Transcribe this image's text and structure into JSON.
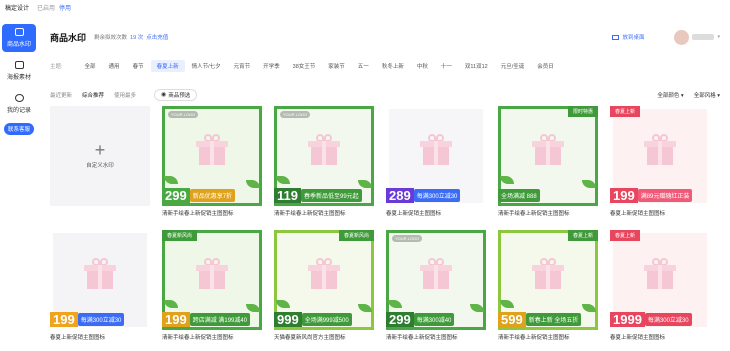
{
  "topbar": {
    "brand": "稿定设计",
    "sep": "·",
    "status": "已启用",
    "action": "停用"
  },
  "sidebar": {
    "items": [
      {
        "label": "商品水印",
        "icon": "image-icon",
        "active": true
      },
      {
        "label": "海报素材",
        "icon": "poster-icon",
        "active": false
      },
      {
        "label": "我的记录",
        "icon": "history-icon",
        "active": false
      }
    ],
    "service_label": "联系客服"
  },
  "header": {
    "title": "商品水印",
    "remaining_label": "剩余拟效次数",
    "remaining_count": "19 次",
    "recharge": "点击充值",
    "desktop_label": "放到桌面"
  },
  "topics": {
    "label": "主题:",
    "items": [
      "全部",
      "通用",
      "春节",
      "春夏上新",
      "情人节/七夕",
      "元宵节",
      "开学季",
      "38女王节",
      "家装节",
      "五一",
      "秋冬上新",
      "中秋",
      "十一",
      "双11双12",
      "元旦/圣诞",
      "会员日"
    ],
    "active_index": 3
  },
  "sortbar": {
    "items": [
      "最近更新",
      "综合推荐",
      "使用最多"
    ],
    "active_index": 1,
    "preview": "商品预选",
    "color_filter": "全部颜色 ▾",
    "style_filter": "全部风格 ▾"
  },
  "custom": {
    "label": "自定义水印"
  },
  "cards": [
    {
      "caption": "清新手绘春上新促销主图图标",
      "frame": "#4aa844",
      "bg": "#eef7e8",
      "logo": "YOUR LOGO",
      "banner_text": "新品优惠享7折",
      "banner_bg": "#e0a21b",
      "price": "299",
      "price_bg": "#4aa844",
      "top_tag": "",
      "top_bg": ""
    },
    {
      "caption": "清新手绘春上新促销主图图标",
      "frame": "#4aa844",
      "bg": "#f2f8ee",
      "logo": "YOUR LOGO",
      "banner_text": "春季新品低至99元起",
      "banner_bg": "#3f9b3a",
      "price": "119",
      "price_bg": "#2f7d31",
      "top_tag": "",
      "top_bg": ""
    },
    {
      "caption": "春夏上新促销主图图标",
      "frame": "#ffffff",
      "bg": "#f6f6f8",
      "logo": "",
      "banner_text": "每满300立减30",
      "banner_bg": "#3b6cf6",
      "price": "289",
      "price_bg": "#6a3ad8",
      "top_tag": "",
      "top_bg": ""
    },
    {
      "caption": "清新手绘春上新促销主图图标",
      "frame": "#4aa844",
      "bg": "#f2f8ee",
      "logo": "",
      "banner_text": "全场满减 888",
      "banner_bg": "#3f9b3a",
      "price": "",
      "price_bg": "",
      "top_tag": "限时特惠",
      "top_bg": "#3f9b3a"
    },
    {
      "caption": "春夏上新促销主图图标",
      "frame": "#ffffff",
      "bg": "#fdf1f1",
      "logo": "",
      "banner_text": "满89元赠随红正装",
      "banner_bg": "#f05a78",
      "price": "199",
      "price_bg": "#e8455e",
      "top_tag": "春夏上新",
      "top_bg": "#e8455e"
    },
    {
      "caption": "春夏上新促销主图图标",
      "frame": "#ffffff",
      "bg": "#f4f4f6",
      "logo": "",
      "banner_text": "每满300立减30",
      "banner_bg": "#3b6cf6",
      "price": "199",
      "price_bg": "#f0a31c",
      "top_tag": "",
      "top_bg": ""
    },
    {
      "caption": "清新手绘春上新促销主图图标",
      "frame": "#4aa844",
      "bg": "#eef7e8",
      "logo": "",
      "banner_text": "跨店满减 满199减40",
      "banner_bg": "#3f9b3a",
      "price": "199",
      "price_bg": "#e0a21b",
      "top_tag": "春夏新风尚",
      "top_bg": "#3f9b3a"
    },
    {
      "caption": "天猫春夏新风尚官方主图图标",
      "frame": "#8dc63f",
      "bg": "#f4f9ec",
      "logo": "",
      "banner_text": "全场满999减500",
      "banner_bg": "#3f9b3a",
      "price": "999",
      "price_bg": "#2f7d31",
      "top_tag": "春夏新风尚",
      "top_bg": "#3f9b3a"
    },
    {
      "caption": "清新手绘春上新促销主图图标",
      "frame": "#4aa844",
      "bg": "#f2f8ee",
      "logo": "YOUR LOGO",
      "banner_text": "每满300减40",
      "banner_bg": "#3f9b3a",
      "price": "299",
      "price_bg": "#2f7d31",
      "top_tag": "",
      "top_bg": ""
    },
    {
      "caption": "清新手绘春上新促销主图图标",
      "frame": "#8dc63f",
      "bg": "#f4f9ec",
      "logo": "",
      "banner_text": "新春上新 全场五折",
      "banner_bg": "#3f9b3a",
      "price": "599",
      "price_bg": "#e0a21b",
      "top_tag": "春夏上新",
      "top_bg": "#3f9b3a"
    },
    {
      "caption": "春夏上新促销主图图标",
      "frame": "#ffffff",
      "bg": "#fdf1f1",
      "logo": "",
      "banner_text": "每满300立减30",
      "banner_bg": "#e8455e",
      "price": "1999",
      "price_bg": "#e8455e",
      "top_tag": "春夏上新",
      "top_bg": "#e8455e"
    }
  ]
}
